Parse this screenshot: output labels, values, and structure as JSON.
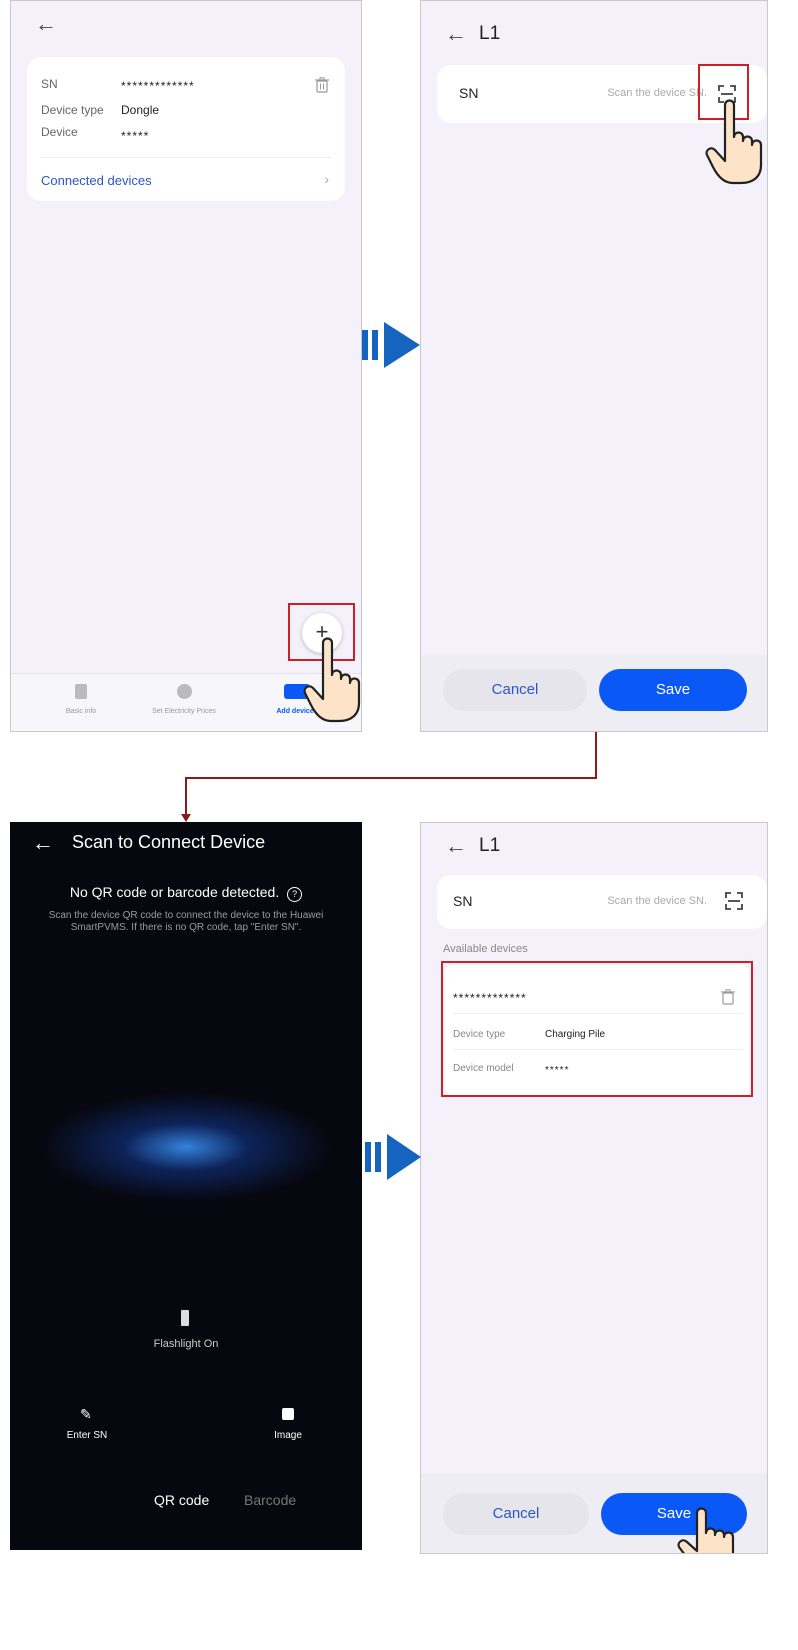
{
  "screen1": {
    "sn_label": "SN",
    "sn_value": "*************",
    "device_type_label": "Device type",
    "device_type_value": "Dongle",
    "device_label": "Device",
    "device_value": "*****",
    "connected_devices": "Connected devices",
    "add_button": "+",
    "tabs": [
      "Basic info",
      "Set Electricity Prices",
      "Add devices"
    ]
  },
  "screen2": {
    "title": "L1",
    "sn_label": "SN",
    "sn_placeholder": "Scan the device SN.",
    "cancel": "Cancel",
    "save": "Save"
  },
  "screen3": {
    "title": "Scan to Connect Device",
    "status": "No QR code or barcode detected.",
    "instructions": "Scan the device QR code to connect the device to the Huawei SmartPVMS. If there is no QR code, tap \"Enter SN\".",
    "flashlight": "Flashlight On",
    "enter_sn": "Enter SN",
    "image": "Image",
    "mode_qr": "QR code",
    "mode_barcode": "Barcode"
  },
  "screen4": {
    "title": "L1",
    "sn_label": "SN",
    "sn_placeholder": "Scan the device SN.",
    "available_devices": "Available devices",
    "device_sn": "*************",
    "device_type_label": "Device type",
    "device_type_value": "Charging Pile",
    "device_model_label": "Device model",
    "device_model_value": "*****",
    "cancel": "Cancel",
    "save": "Save"
  },
  "colors": {
    "accent": "#0a59f7",
    "highlight": "#cc2027",
    "flow_arrow": "#1565c0",
    "link": "#2a55c9"
  }
}
